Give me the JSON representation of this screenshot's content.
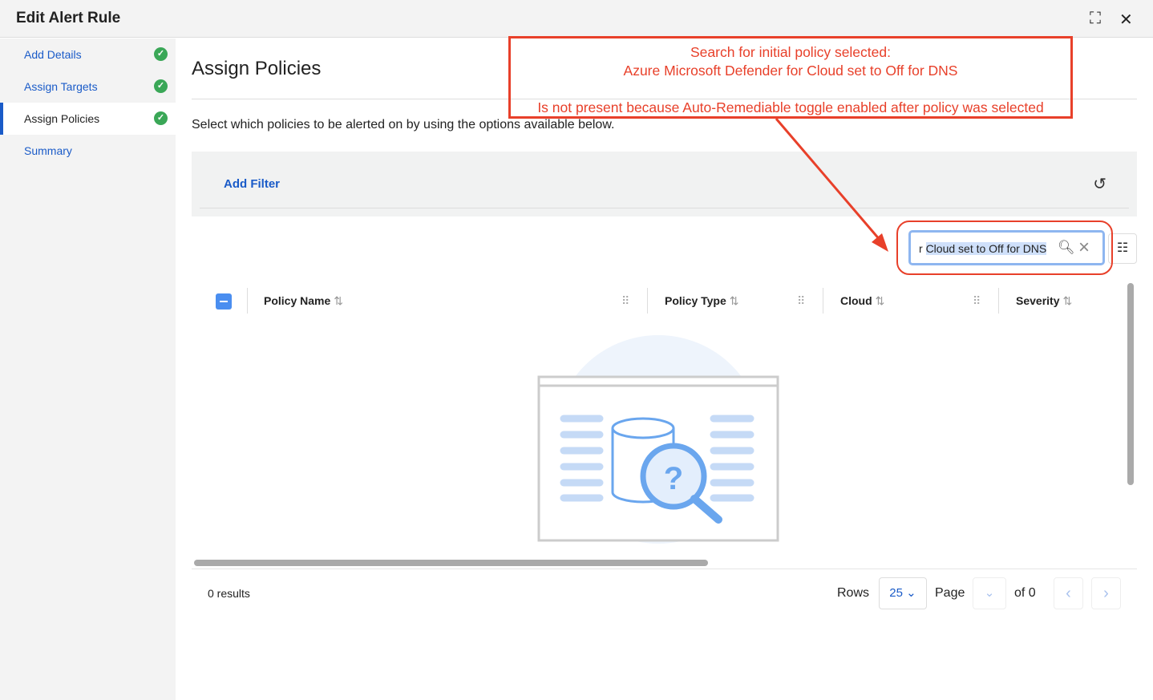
{
  "header": {
    "title": "Edit Alert Rule"
  },
  "sidebar": {
    "items": [
      {
        "label": "Add Details",
        "done": true
      },
      {
        "label": "Assign Targets",
        "done": true
      },
      {
        "label": "Assign Policies",
        "done": true,
        "active": true
      },
      {
        "label": "Summary",
        "done": false
      }
    ]
  },
  "main": {
    "title": "Assign Policies",
    "description": "Select which policies to be alerted on by using the options available below.",
    "add_filter": "Add Filter",
    "search": {
      "prefix": "r ",
      "selected": "Cloud set to Off for DNS"
    },
    "columns": [
      {
        "label": "Policy Name"
      },
      {
        "label": "Policy Type"
      },
      {
        "label": "Cloud"
      },
      {
        "label": "Severity"
      }
    ],
    "results": "0 results",
    "pagination": {
      "rows_label": "Rows",
      "rows_value": "25",
      "page_label": "Page",
      "of_label": "of 0"
    }
  },
  "annotation": {
    "line1": "Search for initial policy selected:",
    "line2": "Azure Microsoft Defender for Cloud set to Off for DNS",
    "line3": "Is not present because Auto-Remediable toggle enabled after policy was selected",
    "color": "#e8402a"
  }
}
